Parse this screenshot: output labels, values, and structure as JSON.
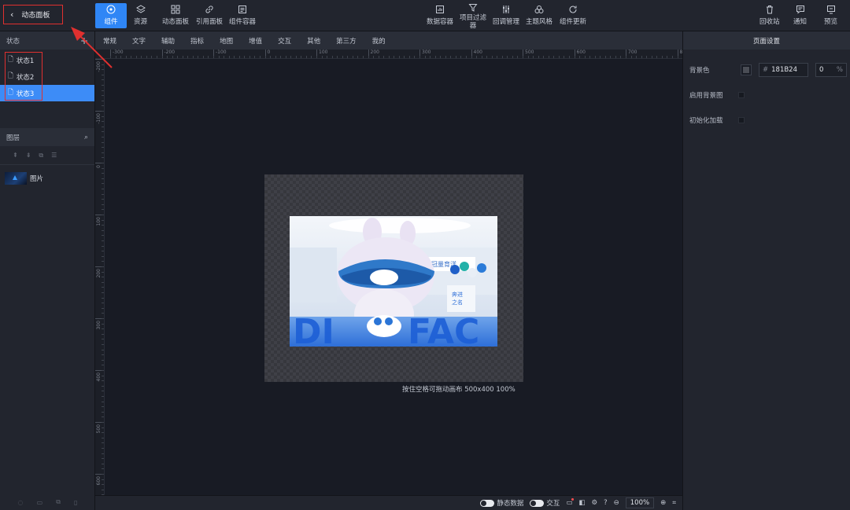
{
  "header": {
    "back_label": "动态面板",
    "tools_left": [
      {
        "label": "组件",
        "icon": "component-icon",
        "active": true
      },
      {
        "label": "资源",
        "icon": "layers-stack-icon"
      },
      {
        "label": "动态面板",
        "icon": "grid-panel-icon"
      },
      {
        "label": "引用面板",
        "icon": "link-icon"
      },
      {
        "label": "组件容器",
        "icon": "container-icon"
      }
    ],
    "tools_center": [
      {
        "label": "数据容器",
        "icon": "data-container-icon"
      },
      {
        "label": "项目过滤器",
        "icon": "filter-icon"
      },
      {
        "label": "回调管理",
        "icon": "sliders-icon"
      },
      {
        "label": "主题风格",
        "icon": "theme-icon"
      },
      {
        "label": "组件更新",
        "icon": "refresh-icon"
      }
    ],
    "tools_right": [
      {
        "label": "回收站",
        "icon": "trash-icon"
      },
      {
        "label": "通知",
        "icon": "message-icon"
      },
      {
        "label": "预览",
        "icon": "preview-icon"
      }
    ]
  },
  "tabs": [
    "常规",
    "文字",
    "辅助",
    "指标",
    "地图",
    "增值",
    "交互",
    "其他",
    "第三方",
    "我的"
  ],
  "left_panel": {
    "states_title": "状态",
    "add_symbol": "+",
    "states": [
      {
        "label": "状态1",
        "selected": false
      },
      {
        "label": "状态2",
        "selected": false
      },
      {
        "label": "状态3",
        "selected": true
      }
    ],
    "layers_title": "图层",
    "layer_tools": [
      "⇞",
      "⇟",
      "⧉",
      "☰"
    ],
    "layers": [
      {
        "label": "图片"
      }
    ]
  },
  "right_panel": {
    "title": "页面设置",
    "bg_label": "背景色",
    "bg_hash": "#",
    "bg_value": "181B24",
    "opacity_value": "0",
    "opacity_unit": "%",
    "bg_image_label": "启用背景图",
    "init_load_label": "初始化加载"
  },
  "rulers": {
    "top": [
      "-300",
      "-200",
      "-100",
      "0",
      "100",
      "200",
      "300",
      "400",
      "500",
      "600",
      "700",
      "8"
    ],
    "left": [
      "-200",
      "-100",
      "0",
      "100",
      "200",
      "300",
      "400",
      "500",
      "600"
    ]
  },
  "canvas": {
    "info": "按住空格可拖动画布  500x400 100%"
  },
  "bottom_bar": {
    "static_data_label": "静态数据",
    "interaction_label": "交互",
    "zoom_value": "100%"
  },
  "colors": {
    "accent": "#2f86f6",
    "highlight_red": "#e0302f",
    "background": "#181b24"
  }
}
